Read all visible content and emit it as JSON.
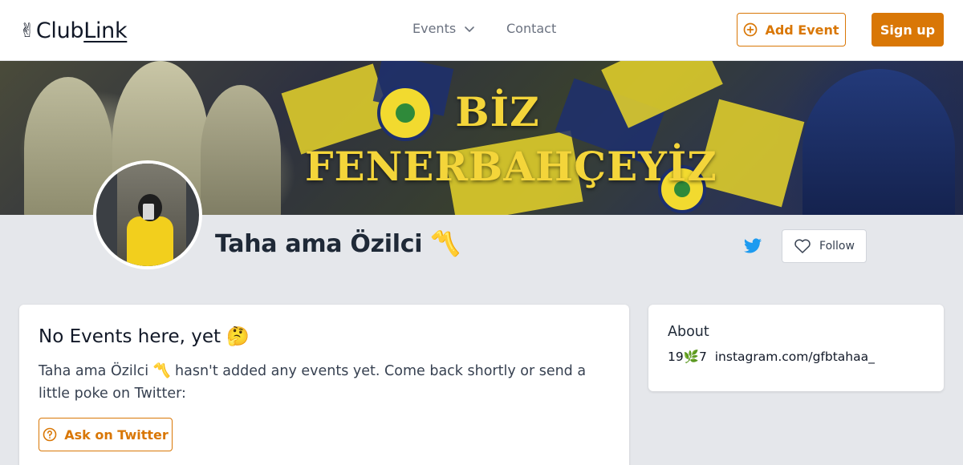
{
  "header": {
    "logo_hand": "✌",
    "logo_club": "Club",
    "logo_link": "Link",
    "nav": {
      "events_label": "Events",
      "contact_label": "Contact"
    },
    "add_event_label": "Add Event",
    "sign_up_label": "Sign up"
  },
  "banner": {
    "title_line1": "BİZ",
    "title_line2": "FENERBAHÇEYİZ"
  },
  "profile": {
    "name": "Taha ama Özilci 〽️",
    "follow_label": "Follow"
  },
  "events": {
    "title": "No Events here, yet 🤔",
    "message": "Taha ama Özilci 〽️ hasn't added any events yet. Come back shortly or send a little poke on Twitter:",
    "ask_label": "Ask on Twitter"
  },
  "about": {
    "title": "About",
    "text": "19🌿7 ￼ instagram.com/gfbtahaa_"
  },
  "colors": {
    "accent": "#d97706",
    "twitter": "#1d9bf0",
    "page_background": "#e5e7eb"
  },
  "icons": {
    "logo": "victory-hand-icon",
    "events_dropdown": "chevron-down-icon",
    "add_event": "plus-circle-icon",
    "twitter": "twitter-bird-icon",
    "follow": "heart-outline-icon",
    "ask": "question-circle-icon"
  }
}
